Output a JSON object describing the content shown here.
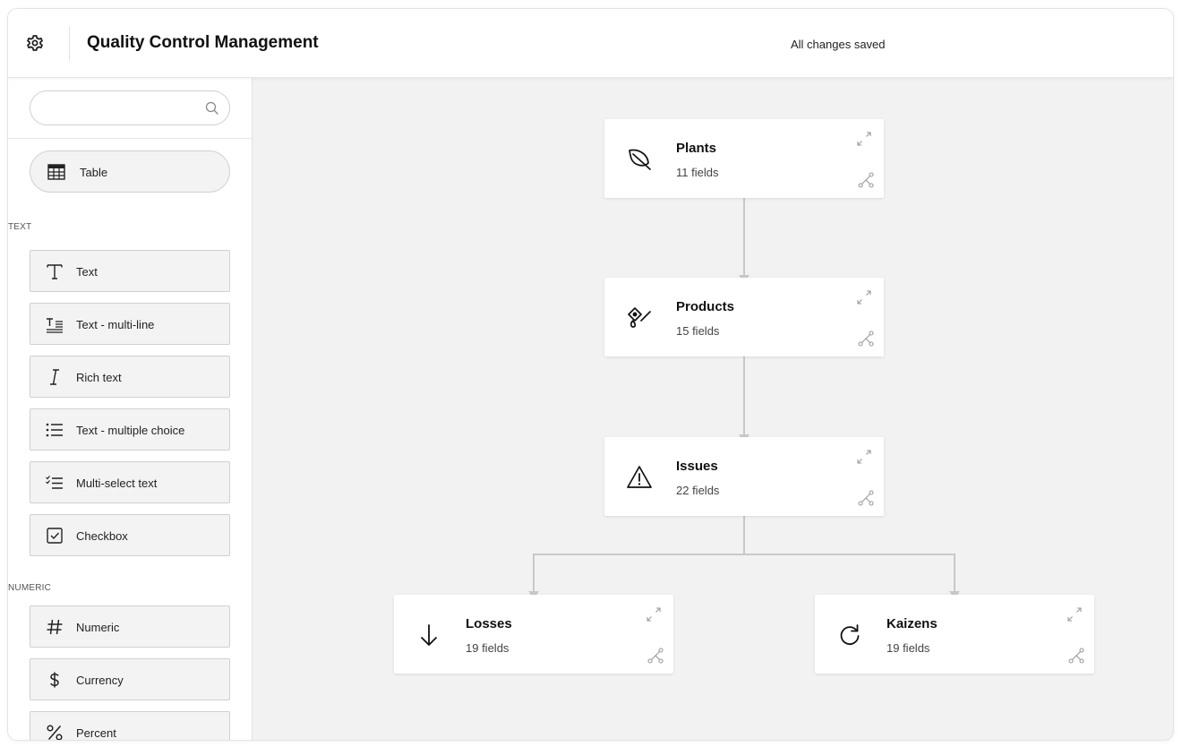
{
  "header": {
    "title": "Quality Control Management",
    "status": "All changes saved",
    "settings_icon": "gear-icon"
  },
  "sidebar": {
    "search": {
      "value": "",
      "placeholder": "",
      "icon": "search-icon"
    },
    "table_button": {
      "label": "Table",
      "icon": "table-grid-icon"
    },
    "sections": [
      {
        "title": "TEXT",
        "items": [
          {
            "label": "Text",
            "icon": "text-icon"
          },
          {
            "label": "Text - multi-line",
            "icon": "text-multiline-icon"
          },
          {
            "label": "Rich text",
            "icon": "italic-icon"
          },
          {
            "label": "Text - multiple choice",
            "icon": "list-icon"
          },
          {
            "label": "Multi-select text",
            "icon": "checklist-icon"
          },
          {
            "label": "Checkbox",
            "icon": "checkbox-icon"
          }
        ]
      },
      {
        "title": "NUMERIC",
        "items": [
          {
            "label": "Numeric",
            "icon": "hash-icon"
          },
          {
            "label": "Currency",
            "icon": "dollar-icon"
          },
          {
            "label": "Percent",
            "icon": "percent-icon"
          }
        ]
      }
    ]
  },
  "diagram": {
    "nodes": [
      {
        "id": "plants",
        "title": "Plants",
        "fields": "11 fields",
        "icon": "leaf-icon"
      },
      {
        "id": "products",
        "title": "Products",
        "fields": "15 fields",
        "icon": "product-tag-icon"
      },
      {
        "id": "issues",
        "title": "Issues",
        "fields": "22 fields",
        "icon": "warning-icon"
      },
      {
        "id": "losses",
        "title": "Losses",
        "fields": "19 fields",
        "icon": "arrow-down-icon"
      },
      {
        "id": "kaizens",
        "title": "Kaizens",
        "fields": "19 fields",
        "icon": "refresh-icon"
      }
    ],
    "edges": [
      {
        "from": "plants",
        "to": "products"
      },
      {
        "from": "products",
        "to": "issues"
      },
      {
        "from": "issues",
        "to": "losses"
      },
      {
        "from": "issues",
        "to": "kaizens"
      }
    ],
    "connector_color": "#c8c8c8"
  }
}
